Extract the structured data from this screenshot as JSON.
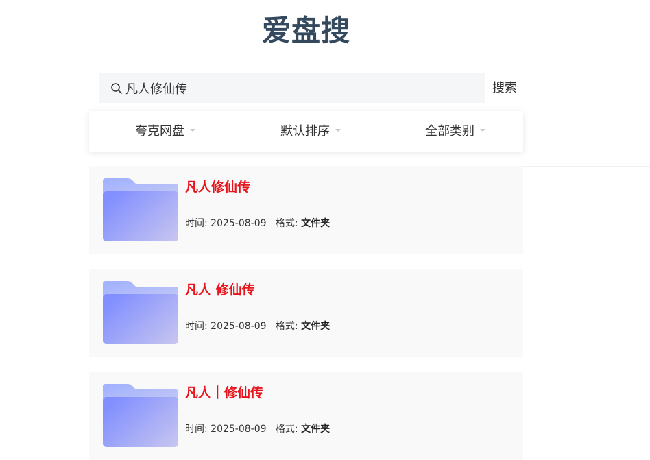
{
  "app": {
    "title": "爱盘搜"
  },
  "search": {
    "value": "凡人修仙传",
    "button_label": "搜索"
  },
  "filters": {
    "drive": "夸克网盘",
    "sort": "默认排序",
    "category": "全部类别"
  },
  "results": [
    {
      "title": "凡人修仙传",
      "time_label": "时间:",
      "time": "2025-08-09",
      "format_label": "格式:",
      "format": "文件夹"
    },
    {
      "title": "凡人 修仙传",
      "time_label": "时间:",
      "time": "2025-08-09",
      "format_label": "格式:",
      "format": "文件夹"
    },
    {
      "title": "凡人｜修仙传",
      "time_label": "时间:",
      "time": "2025-08-09",
      "format_label": "格式:",
      "format": "文件夹"
    }
  ],
  "icons": {
    "search": "search-icon",
    "folder": "folder-icon",
    "dropdown": "chevron-down-icon"
  },
  "colors": {
    "title": "#34495e",
    "result_title": "#e8141b",
    "folder": "#8f9bff"
  }
}
